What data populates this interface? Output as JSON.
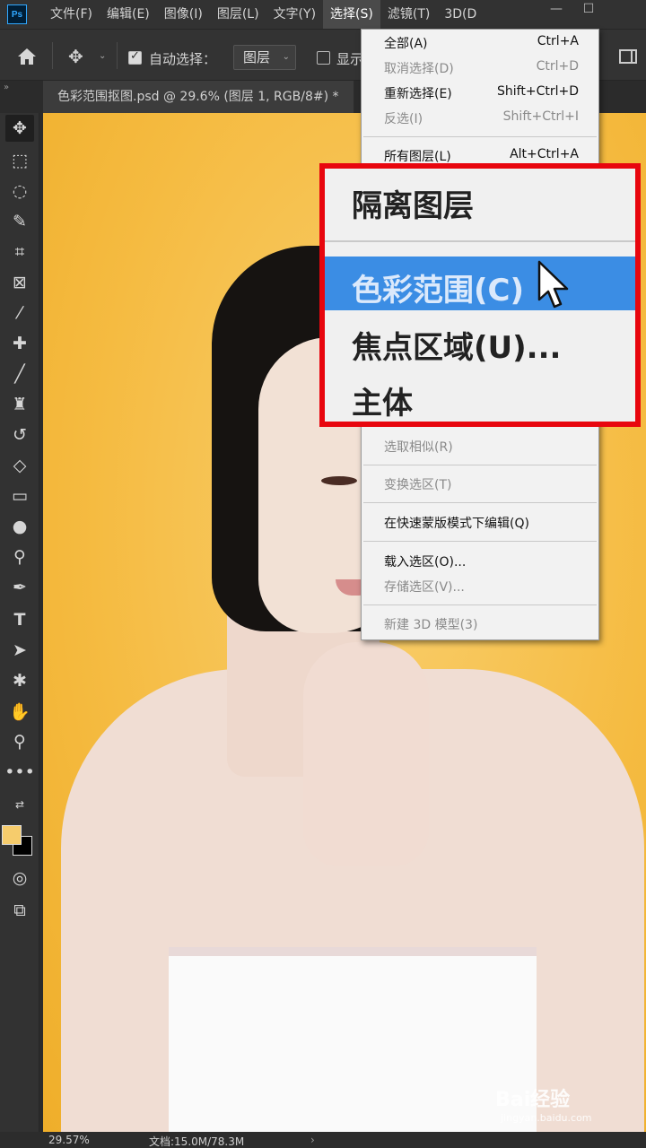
{
  "app": {
    "logo_text": "Ps"
  },
  "menubar": {
    "items": [
      "文件(F)",
      "编辑(E)",
      "图像(I)",
      "图层(L)",
      "文字(Y)",
      "选择(S)",
      "滤镜(T)",
      "3D(D"
    ],
    "active_index": 5,
    "window_controls": [
      "—",
      "☐"
    ]
  },
  "optionsbar": {
    "auto_select_label": "自动选择：",
    "auto_select_checked": true,
    "auto_select_value": "图层",
    "show_label": "显示"
  },
  "document": {
    "tab_title": "色彩范围抠图.psd @ 29.6% (图层 1, RGB/8#) *"
  },
  "select_menu": {
    "items": [
      {
        "label": "全部(A)",
        "shortcut": "Ctrl+A",
        "disabled": false
      },
      {
        "label": "取消选择(D)",
        "shortcut": "Ctrl+D",
        "disabled": true
      },
      {
        "label": "重新选择(E)",
        "shortcut": "Shift+Ctrl+D",
        "disabled": false
      },
      {
        "label": "反选(I)",
        "shortcut": "Shift+Ctrl+I",
        "disabled": true
      },
      {
        "label": "所有图层(L)",
        "shortcut": "Alt+Ctrl+A",
        "disabled": false
      },
      {
        "label": "选取相似(R)",
        "shortcut": "",
        "disabled": true
      },
      {
        "label": "变换选区(T)",
        "shortcut": "",
        "disabled": true
      },
      {
        "label": "在快速蒙版模式下编辑(Q)",
        "shortcut": "",
        "disabled": false
      },
      {
        "label": "载入选区(O)...",
        "shortcut": "",
        "disabled": false
      },
      {
        "label": "存储选区(V)...",
        "shortcut": "",
        "disabled": true
      },
      {
        "label": "新建 3D 模型(3)",
        "shortcut": "",
        "disabled": true
      }
    ]
  },
  "callout": {
    "items": [
      "隔离图层",
      "色彩范围(C)",
      "焦点区域(U)...",
      "主体"
    ],
    "highlighted_index": 1,
    "border_color": "#e8060e",
    "highlight_color": "#3b8de4"
  },
  "colors": {
    "foreground": "#f6cc6c",
    "background": "#000000"
  },
  "status": {
    "zoom": "29.57%",
    "doc_info": "文档:15.0M/78.3M"
  },
  "watermark": {
    "brand": "Bai经验",
    "url": "jingyan.baidu.com"
  }
}
